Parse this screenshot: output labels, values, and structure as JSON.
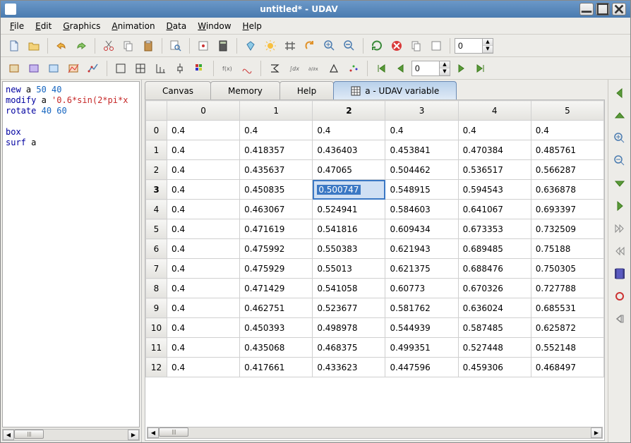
{
  "window": {
    "title": "untitled* - UDAV"
  },
  "menu": {
    "file": "File",
    "edit": "Edit",
    "graphics": "Graphics",
    "animation": "Animation",
    "data": "Data",
    "window": "Window",
    "help": "Help"
  },
  "toolbar1": {
    "spin": "0"
  },
  "toolbar2": {
    "spin": "0"
  },
  "script": {
    "l1a": "new",
    "l1b": " a ",
    "l1c": "50 40",
    "l2a": "modify",
    "l2b": " a ",
    "l2c": "'0.6*sin(2*pi*x",
    "l3a": "rotate",
    "l3b": " ",
    "l3c": "40 60",
    "l4": "",
    "l5": "box",
    "l6a": "surf",
    "l6b": " a"
  },
  "tabs": {
    "canvas": "Canvas",
    "memory": "Memory",
    "help": "Help",
    "var": "a - UDAV variable"
  },
  "table": {
    "cols": [
      "0",
      "1",
      "2",
      "3",
      "4",
      "5"
    ],
    "sel_col": 2,
    "sel_row": 3,
    "rows": [
      {
        "h": "0",
        "c": [
          "0.4",
          "0.4",
          "0.4",
          "0.4",
          "0.4",
          "0.4"
        ]
      },
      {
        "h": "1",
        "c": [
          "0.4",
          "0.418357",
          "0.436403",
          "0.453841",
          "0.470384",
          "0.485761"
        ]
      },
      {
        "h": "2",
        "c": [
          "0.4",
          "0.435637",
          "0.47065",
          "0.504462",
          "0.536517",
          "0.566287"
        ]
      },
      {
        "h": "3",
        "c": [
          "0.4",
          "0.450835",
          "0.500747",
          "0.548915",
          "0.594543",
          "0.636878"
        ]
      },
      {
        "h": "4",
        "c": [
          "0.4",
          "0.463067",
          "0.524941",
          "0.584603",
          "0.641067",
          "0.693397"
        ]
      },
      {
        "h": "5",
        "c": [
          "0.4",
          "0.471619",
          "0.541816",
          "0.609434",
          "0.673353",
          "0.732509"
        ]
      },
      {
        "h": "6",
        "c": [
          "0.4",
          "0.475992",
          "0.550383",
          "0.621943",
          "0.689485",
          "0.75188"
        ]
      },
      {
        "h": "7",
        "c": [
          "0.4",
          "0.475929",
          "0.55013",
          "0.621375",
          "0.688476",
          "0.750305"
        ]
      },
      {
        "h": "8",
        "c": [
          "0.4",
          "0.471429",
          "0.541058",
          "0.60773",
          "0.670326",
          "0.727788"
        ]
      },
      {
        "h": "9",
        "c": [
          "0.4",
          "0.462751",
          "0.523677",
          "0.581762",
          "0.636024",
          "0.685531"
        ]
      },
      {
        "h": "10",
        "c": [
          "0.4",
          "0.450393",
          "0.498978",
          "0.544939",
          "0.587485",
          "0.625872"
        ]
      },
      {
        "h": "11",
        "c": [
          "0.4",
          "0.435068",
          "0.468375",
          "0.499351",
          "0.527448",
          "0.552148"
        ]
      },
      {
        "h": "12",
        "c": [
          "0.4",
          "0.417661",
          "0.433623",
          "0.447596",
          "0.459306",
          "0.468497"
        ]
      }
    ]
  }
}
